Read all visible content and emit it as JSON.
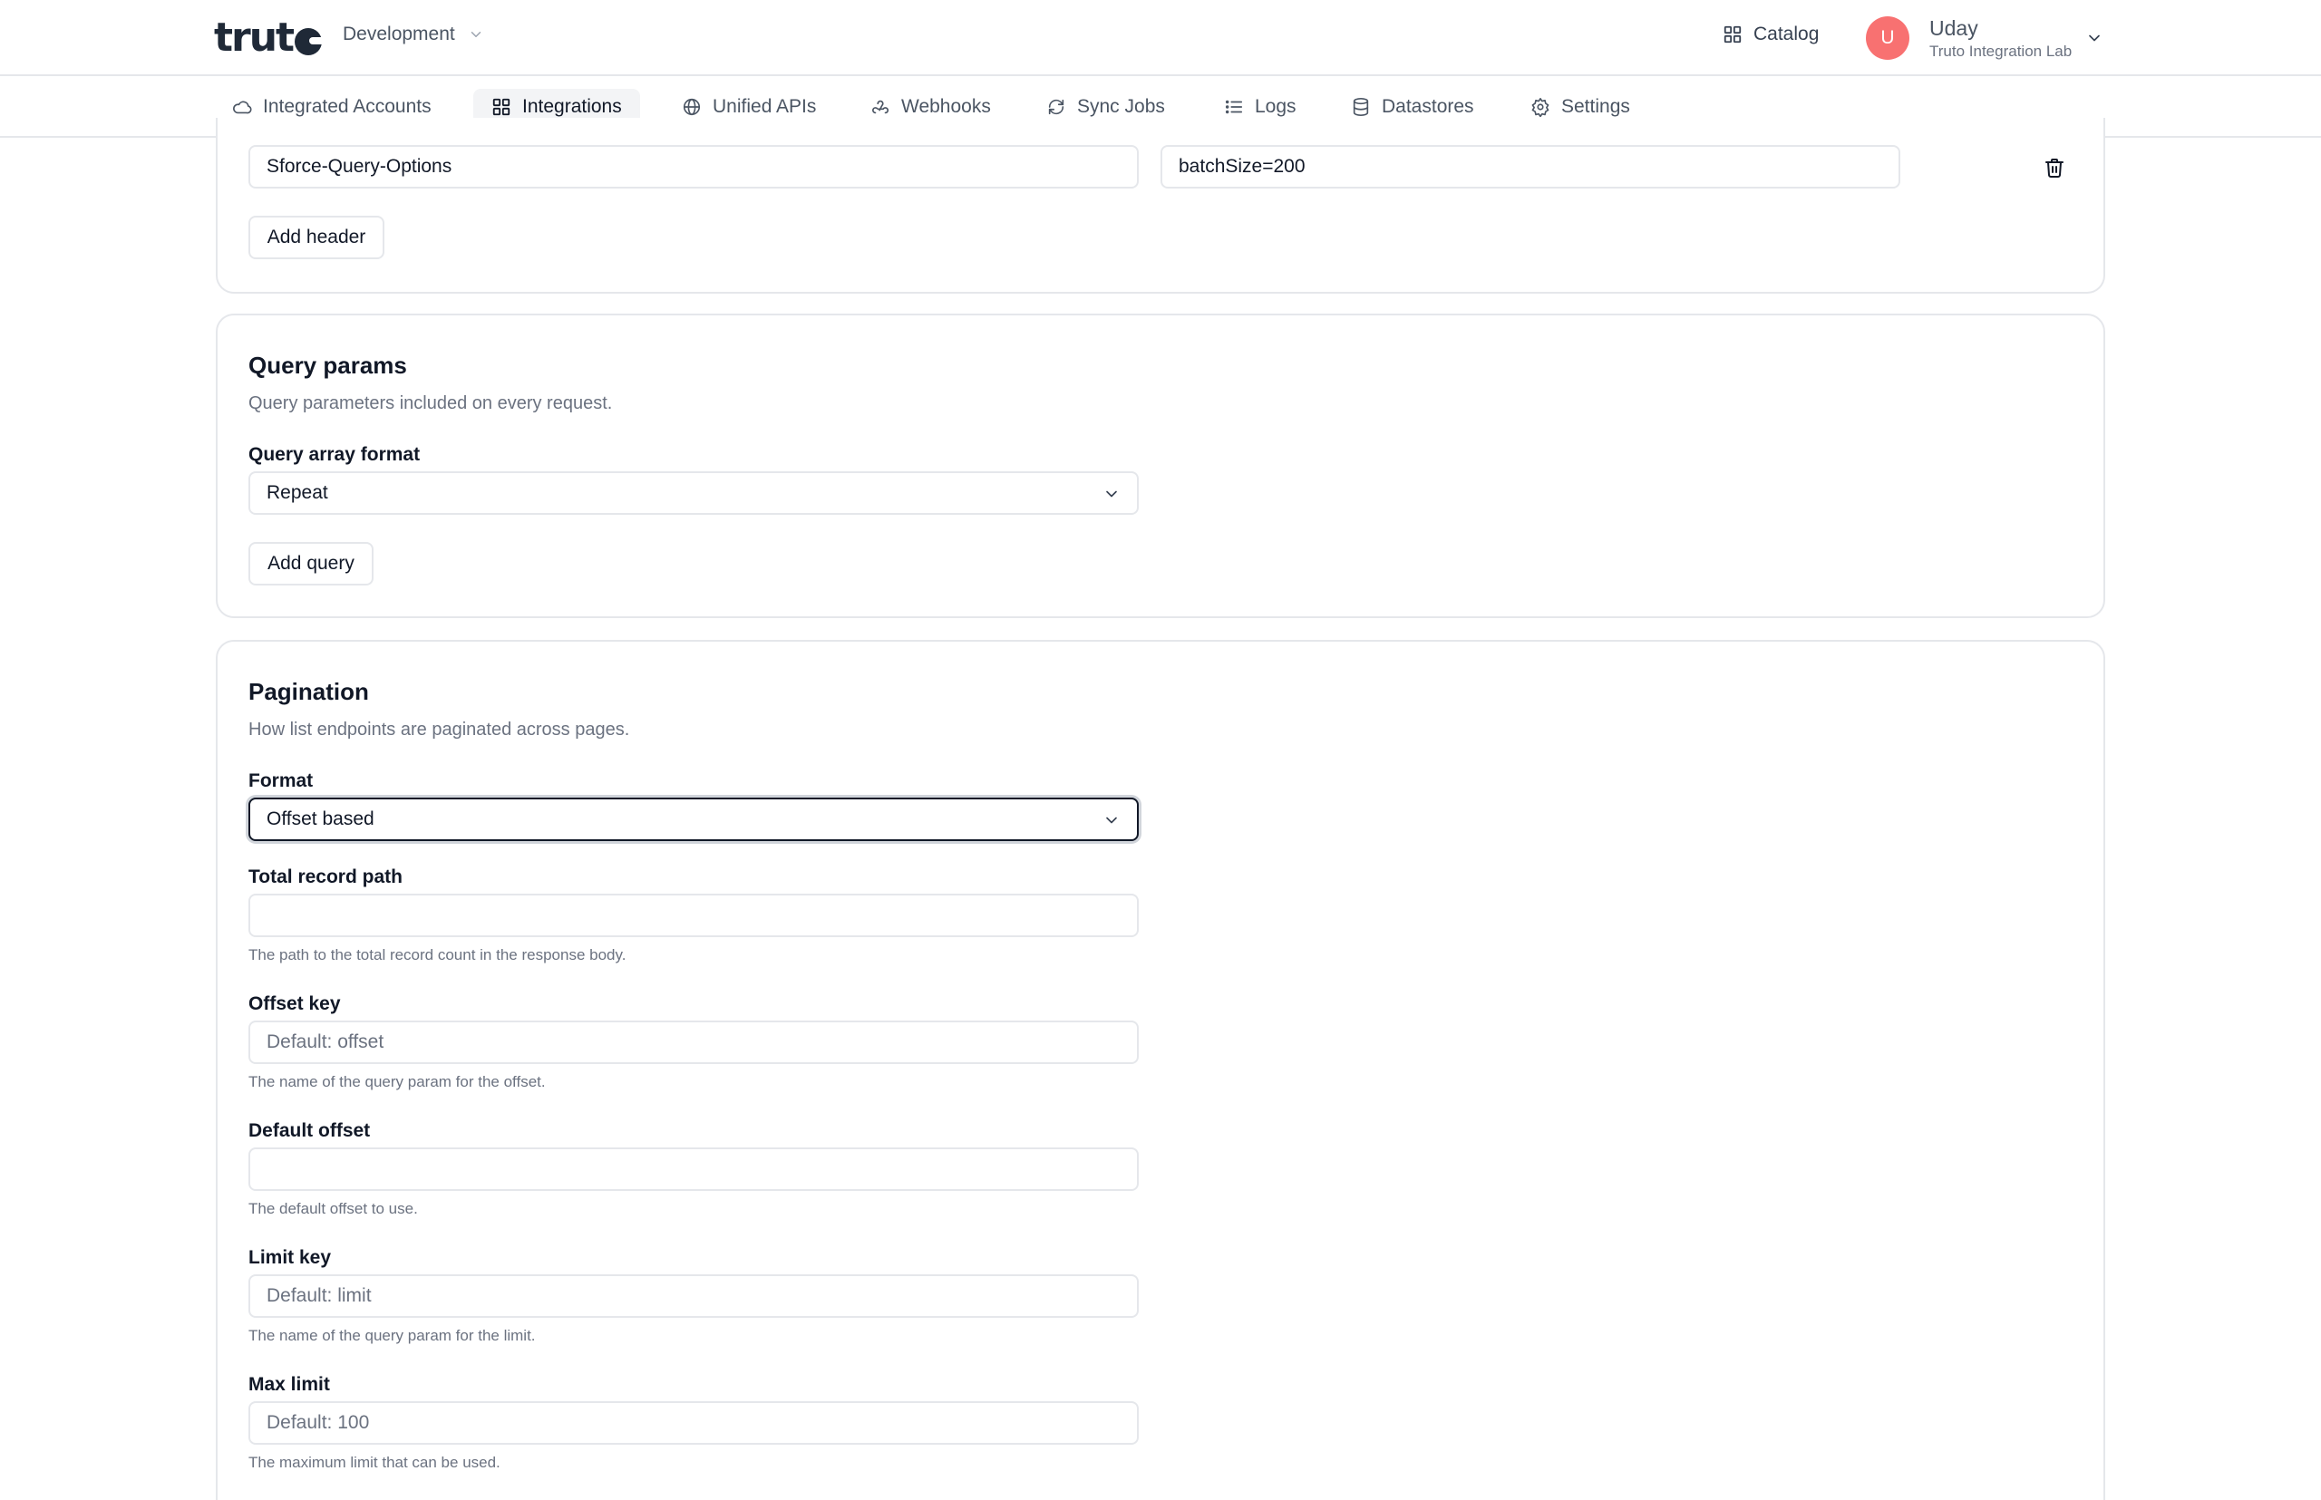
{
  "header": {
    "logo_text": "truto",
    "environment": "Development",
    "catalog_label": "Catalog",
    "user": {
      "initial": "U",
      "name": "Uday",
      "org": "Truto Integration Lab"
    }
  },
  "nav": {
    "tabs": [
      {
        "label": "Integrated Accounts",
        "icon": "cloud-icon",
        "active": false
      },
      {
        "label": "Integrations",
        "icon": "grid-icon",
        "active": true
      },
      {
        "label": "Unified APIs",
        "icon": "globe-icon",
        "active": false
      },
      {
        "label": "Webhooks",
        "icon": "webhook-icon",
        "active": false
      },
      {
        "label": "Sync Jobs",
        "icon": "sync-icon",
        "active": false
      },
      {
        "label": "Logs",
        "icon": "list-icon",
        "active": false
      },
      {
        "label": "Datastores",
        "icon": "database-icon",
        "active": false
      },
      {
        "label": "Settings",
        "icon": "gear-icon",
        "active": false
      }
    ]
  },
  "headers_section": {
    "row": {
      "key": "Sforce-Query-Options",
      "value": "batchSize=200"
    },
    "add_button": "Add header"
  },
  "query_section": {
    "title": "Query params",
    "description": "Query parameters included on every request.",
    "array_format_label": "Query array format",
    "array_format_value": "Repeat",
    "add_button": "Add query"
  },
  "pagination_section": {
    "title": "Pagination",
    "description": "How list endpoints are paginated across pages.",
    "format_label": "Format",
    "format_value": "Offset based",
    "fields": {
      "total_record_path": {
        "label": "Total record path",
        "value": "",
        "placeholder": "",
        "hint": "The path to the total record count in the response body."
      },
      "offset_key": {
        "label": "Offset key",
        "value": "",
        "placeholder": "Default: offset",
        "hint": "The name of the query param for the offset."
      },
      "default_offset": {
        "label": "Default offset",
        "value": "",
        "placeholder": "",
        "hint": "The default offset to use."
      },
      "limit_key": {
        "label": "Limit key",
        "value": "",
        "placeholder": "Default: limit",
        "hint": "The name of the query param for the limit."
      },
      "max_limit": {
        "label": "Max limit",
        "value": "",
        "placeholder": "Default: 100",
        "hint": "The maximum limit that can be used."
      }
    }
  }
}
